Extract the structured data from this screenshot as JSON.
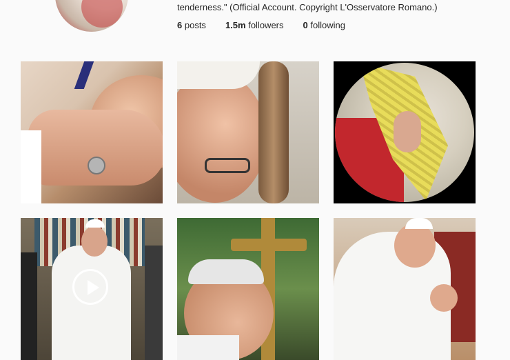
{
  "profile": {
    "bio_line": "tenderness.\" (Official Account. Copyright L'Osservatore Romano.)",
    "stats": [
      {
        "value": "6",
        "label": "posts"
      },
      {
        "value": "1.5m",
        "label": "followers"
      },
      {
        "value": "0",
        "label": "following"
      }
    ]
  },
  "grid": {
    "posts": [
      {
        "type": "photo"
      },
      {
        "type": "photo"
      },
      {
        "type": "photo"
      },
      {
        "type": "video",
        "icon": "play-icon"
      },
      {
        "type": "photo"
      },
      {
        "type": "photo"
      }
    ]
  }
}
